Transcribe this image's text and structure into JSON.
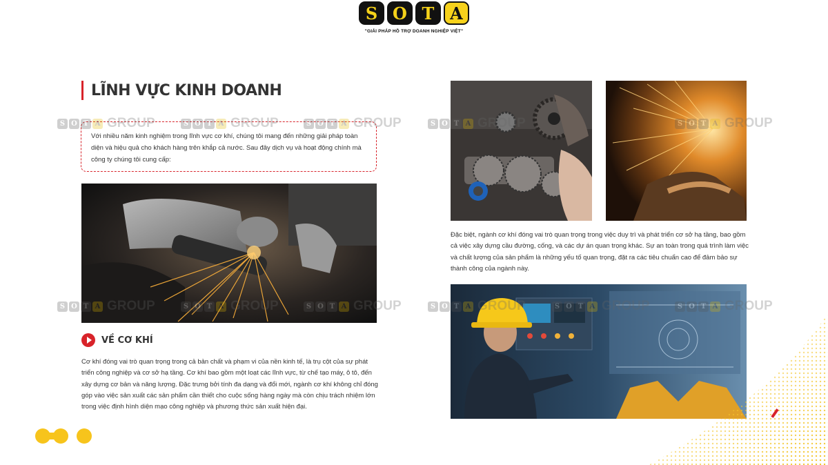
{
  "brand": {
    "letters": [
      "S",
      "O",
      "T",
      "A"
    ],
    "tagline": "\"GIẢI PHÁP HỖ TRỢ DOANH NGHIỆP VIỆT\"",
    "dark": "#111111",
    "yellow": "#f7d21c",
    "accent_red": "#d8232a"
  },
  "heading": "LĨNH VỰC KINH DOANH",
  "intro": "Với nhiều năm kinh nghiệm trong lĩnh vực cơ khí, chúng tôi mang đến những giải pháp toàn diện và hiệu quả cho khách hàng trên khắp cả nước. Sau đây dịch vụ và hoạt động chính mà công ty chúng tôi cung cấp:",
  "section": {
    "title": "VỀ CƠ KHÍ",
    "icon": "play-circle-icon",
    "body": "Cơ khí đóng vai trò quan trọng trong cả bản chất và phạm vi của nền kinh tế, là trụ cột của sự phát triển công nghiệp và cơ sở hạ tầng. Cơ khí bao gồm một loạt các lĩnh vực, từ chế tạo máy, ô tô, đến xây dựng cơ bản và năng lượng. Đặc trưng bởi tính đa dạng và đổi mới, ngành cơ khí không chỉ đóng góp vào việc sản xuất các sản phẩm cần thiết cho cuộc sống hàng ngày mà còn chịu trách nhiệm lớn trong việc định hình diện mạo công nghiệp và phương thức sản xuất hiện đại."
  },
  "right_body": "Đặc biệt, ngành cơ khí đóng vai trò quan trọng trong việc duy trì và phát triển cơ sở hạ tầng, bao gồm cả việc xây dựng cầu đường, cống, và các dự án quan trọng khác. Sự an toàn trong quá trình làm việc và chất lượng của sản phẩm là những yếu tố quan trọng, đặt ra các tiêu chuẩn cao để đảm bảo sự thành công của ngành này.",
  "watermark": {
    "letters": [
      "S",
      "O",
      "T",
      "A"
    ],
    "text": "GROUP"
  },
  "photos": [
    {
      "name": "angle-grinder-sparks-photo"
    },
    {
      "name": "gearbox-parts-photo"
    },
    {
      "name": "welding-sparks-photo"
    },
    {
      "name": "engineer-control-panel-photo"
    }
  ]
}
